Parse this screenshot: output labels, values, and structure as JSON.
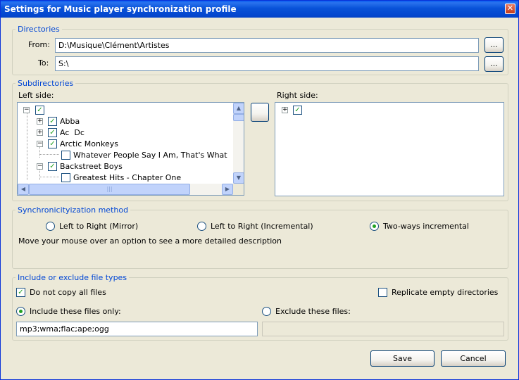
{
  "window": {
    "title": "Settings for Music player synchronization profile"
  },
  "directories": {
    "legend": "Directories",
    "from_label": "From:",
    "from_value": "D:\\Musique\\Clément\\Artistes",
    "to_label": "To:",
    "to_value": "S:\\",
    "browse_label": "..."
  },
  "subdirectories": {
    "legend": "Subdirectories",
    "left_label": "Left side:",
    "right_label": "Right side:",
    "left_tree": [
      {
        "label": "",
        "checked": true
      },
      {
        "label": "Abba",
        "checked": true
      },
      {
        "label": "Ac  Dc",
        "checked": true
      },
      {
        "label": "Arctic Monkeys",
        "checked": true
      },
      {
        "label": "Whatever People Say I Am, That's What",
        "checked": false
      },
      {
        "label": "Backstreet Boys",
        "checked": true
      },
      {
        "label": "Greatest Hits - Chapter One",
        "checked": false
      }
    ],
    "right_tree": [
      {
        "label": "",
        "checked": true
      }
    ],
    "transfer_button_label": ""
  },
  "sync_method": {
    "legend": "Synchronicityization method",
    "options": [
      "Left to Right (Mirror)",
      "Left to Right (Incremental)",
      "Two-ways incremental"
    ],
    "selected": "Two-ways incremental",
    "description": "Move your mouse over an option to see a more detailed description"
  },
  "file_types": {
    "legend": "Include or exclude file types",
    "do_not_copy_all_label": "Do not copy all files",
    "do_not_copy_all_checked": true,
    "replicate_empty_label": "Replicate empty directories",
    "replicate_empty_checked": false,
    "include_label": "Include these files only:",
    "exclude_label": "Exclude these files:",
    "include_value": "mp3;wma;flac;ape;ogg",
    "exclude_value": "",
    "selected": "include"
  },
  "buttons": {
    "save": "Save",
    "cancel": "Cancel"
  },
  "colors": {
    "legend": "#0046d5",
    "titlebar": "#0447cf",
    "check": "#21a121"
  }
}
